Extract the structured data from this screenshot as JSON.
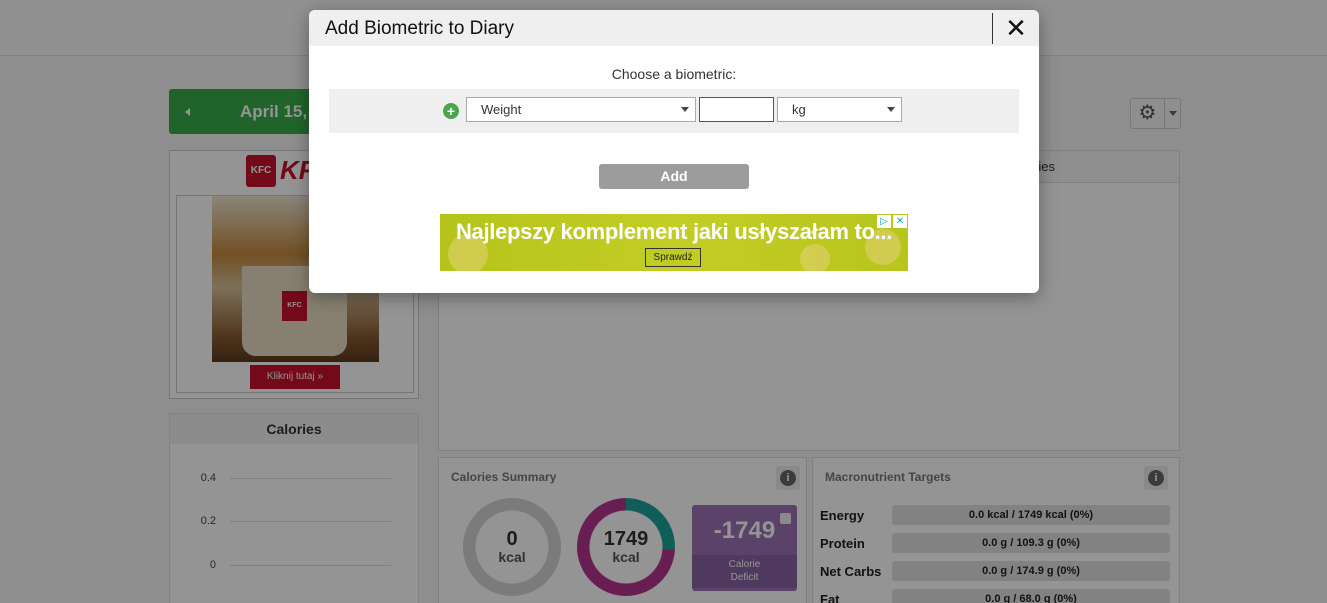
{
  "page": {
    "date_label": "April 15,",
    "ad": {
      "brand": "KFC",
      "cta": "Kliknij tutaj »"
    },
    "calories_chart": {
      "title": "Calories",
      "ticks": [
        "0.4",
        "0.2",
        "0"
      ]
    },
    "main_panel": {
      "header_partial": "ries"
    },
    "calories_summary": {
      "title": "Calories Summary",
      "consumed_value": "0",
      "consumed_unit": "kcal",
      "target_value": "1749",
      "target_unit": "kcal",
      "deficit_value": "-1749",
      "deficit_label_1": "Calorie",
      "deficit_label_2": "Deficit"
    },
    "macro_targets": {
      "title": "Macronutrient Targets",
      "rows": [
        {
          "label": "Energy",
          "value": "0.0 kcal / 1749 kcal (0%)"
        },
        {
          "label": "Protein",
          "value": "0.0 g / 109.3 g (0%)"
        },
        {
          "label": "Net Carbs",
          "value": "0.0 g / 174.9 g (0%)"
        },
        {
          "label": "Fat",
          "value": "0.0 g / 68.0 g (0%)"
        }
      ]
    }
  },
  "modal": {
    "title": "Add Biometric to Diary",
    "close_glyph": "✕",
    "prompt": "Choose a biometric:",
    "biometric_selected": "Weight",
    "value_input": "",
    "unit_selected": "kg",
    "add_label": "Add",
    "banner": {
      "text": "Najlepszy komplement jaki usłyszałam to...",
      "cta": "Sprawdź"
    }
  },
  "colors": {
    "date_green": "#3aad4b",
    "deficit_purple": "#9b72b5",
    "ring_pink": "#b4338f",
    "ring_teal": "#1aa39b",
    "kfc_red": "#c8102e",
    "banner_lime": "#b9c61e"
  },
  "icons": [
    "gear-icon",
    "chevron-down-icon",
    "info-icon",
    "plus-icon",
    "close-icon",
    "clipboard-icon",
    "caret-left-icon",
    "adchoices-icon"
  ]
}
